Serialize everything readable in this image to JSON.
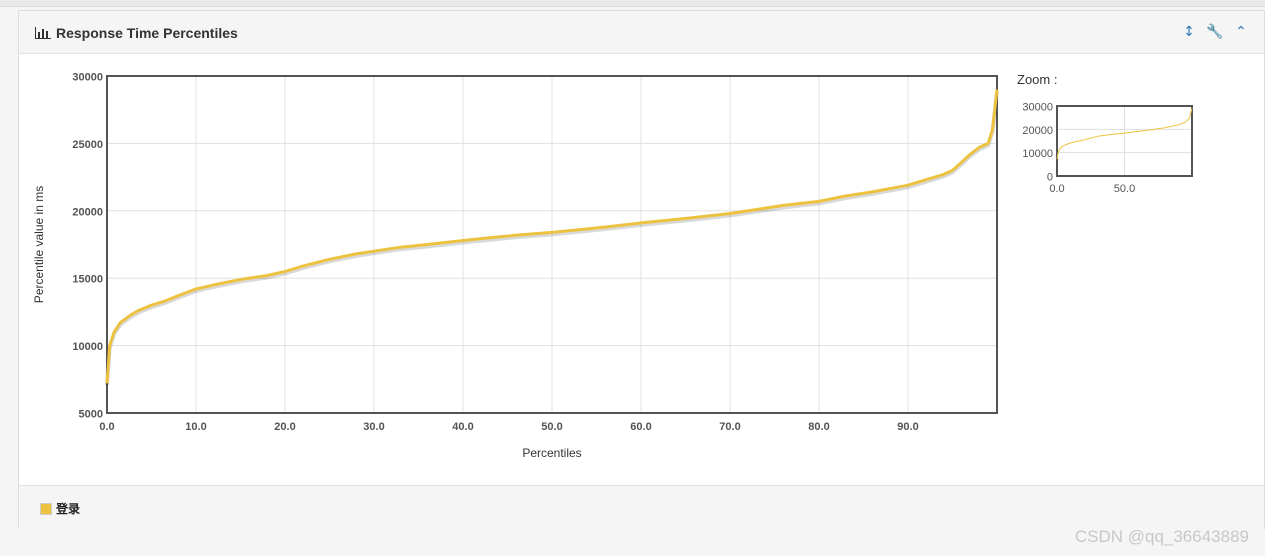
{
  "panel": {
    "title": "Response Time Percentiles",
    "icons": [
      "chart-bar-icon",
      "resize-vertical-icon",
      "wrench-icon",
      "chevron-up-icon"
    ]
  },
  "zoom": {
    "label": "Zoom :"
  },
  "legend": {
    "label": "登录",
    "color": "#edc240"
  },
  "watermark": "CSDN @qq_36643889",
  "chart_data": [
    {
      "type": "line",
      "xlabel": "Percentiles",
      "ylabel": "Percentile value in ms",
      "xlim": [
        0,
        100
      ],
      "ylim": [
        5000,
        30000
      ],
      "xticks": [
        "0.0",
        "10.0",
        "20.0",
        "30.0",
        "40.0",
        "50.0",
        "60.0",
        "70.0",
        "80.0",
        "90.0"
      ],
      "yticks": [
        "5000",
        "10000",
        "15000",
        "20000",
        "25000",
        "30000"
      ],
      "grid": true,
      "series": [
        {
          "name": "登录",
          "color": "#edc240",
          "x": [
            0,
            0.3,
            0.8,
            1.5,
            2.5,
            3.5,
            5,
            6.5,
            8,
            10,
            12,
            15,
            18,
            20,
            22,
            25,
            28,
            30,
            33,
            36,
            40,
            43,
            46,
            50,
            53,
            56,
            60,
            63,
            66,
            70,
            73,
            76,
            80,
            83,
            86,
            90,
            92,
            94,
            95,
            96,
            97,
            98,
            99,
            99.5,
            100
          ],
          "y": [
            7200,
            10000,
            11000,
            11700,
            12200,
            12600,
            13000,
            13300,
            13700,
            14200,
            14500,
            14900,
            15200,
            15500,
            15900,
            16400,
            16800,
            17000,
            17300,
            17500,
            17800,
            18000,
            18200,
            18400,
            18600,
            18800,
            19100,
            19300,
            19500,
            19800,
            20100,
            20400,
            20700,
            21100,
            21400,
            21900,
            22300,
            22700,
            23000,
            23600,
            24200,
            24700,
            25000,
            26000,
            29000
          ]
        }
      ]
    },
    {
      "type": "line",
      "title": "Zoom :",
      "xlim": [
        0,
        100
      ],
      "ylim": [
        0,
        30000
      ],
      "xticks": [
        "0.0",
        "50.0"
      ],
      "yticks": [
        "0",
        "10000",
        "20000",
        "30000"
      ],
      "grid": true,
      "series": [
        {
          "name": "登录",
          "color": "#edc240",
          "x": [
            0,
            1,
            3,
            6,
            10,
            20,
            30,
            40,
            50,
            60,
            70,
            80,
            90,
            95,
            98,
            100
          ],
          "y": [
            7200,
            10500,
            12300,
            13300,
            14200,
            15500,
            17000,
            17800,
            18400,
            19100,
            19800,
            20700,
            21900,
            23000,
            24700,
            29000
          ]
        }
      ]
    }
  ]
}
